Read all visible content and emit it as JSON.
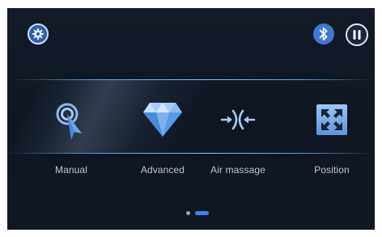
{
  "toolbar": {
    "settings_icon": "gear-icon",
    "bluetooth_icon": "bluetooth-icon",
    "pause_icon": "pause-icon",
    "accent_color": "#3f78cf"
  },
  "menu": {
    "items": [
      {
        "label": "Manual",
        "icon": "touch-pointer-icon"
      },
      {
        "label": "Advanced",
        "icon": "diamond-icon"
      },
      {
        "label": "Air massage",
        "icon": "air-massage-icon"
      },
      {
        "label": "Position",
        "icon": "expand-arrows-icon"
      }
    ]
  },
  "pagination": {
    "current_page": 2,
    "total_pages": 2
  }
}
